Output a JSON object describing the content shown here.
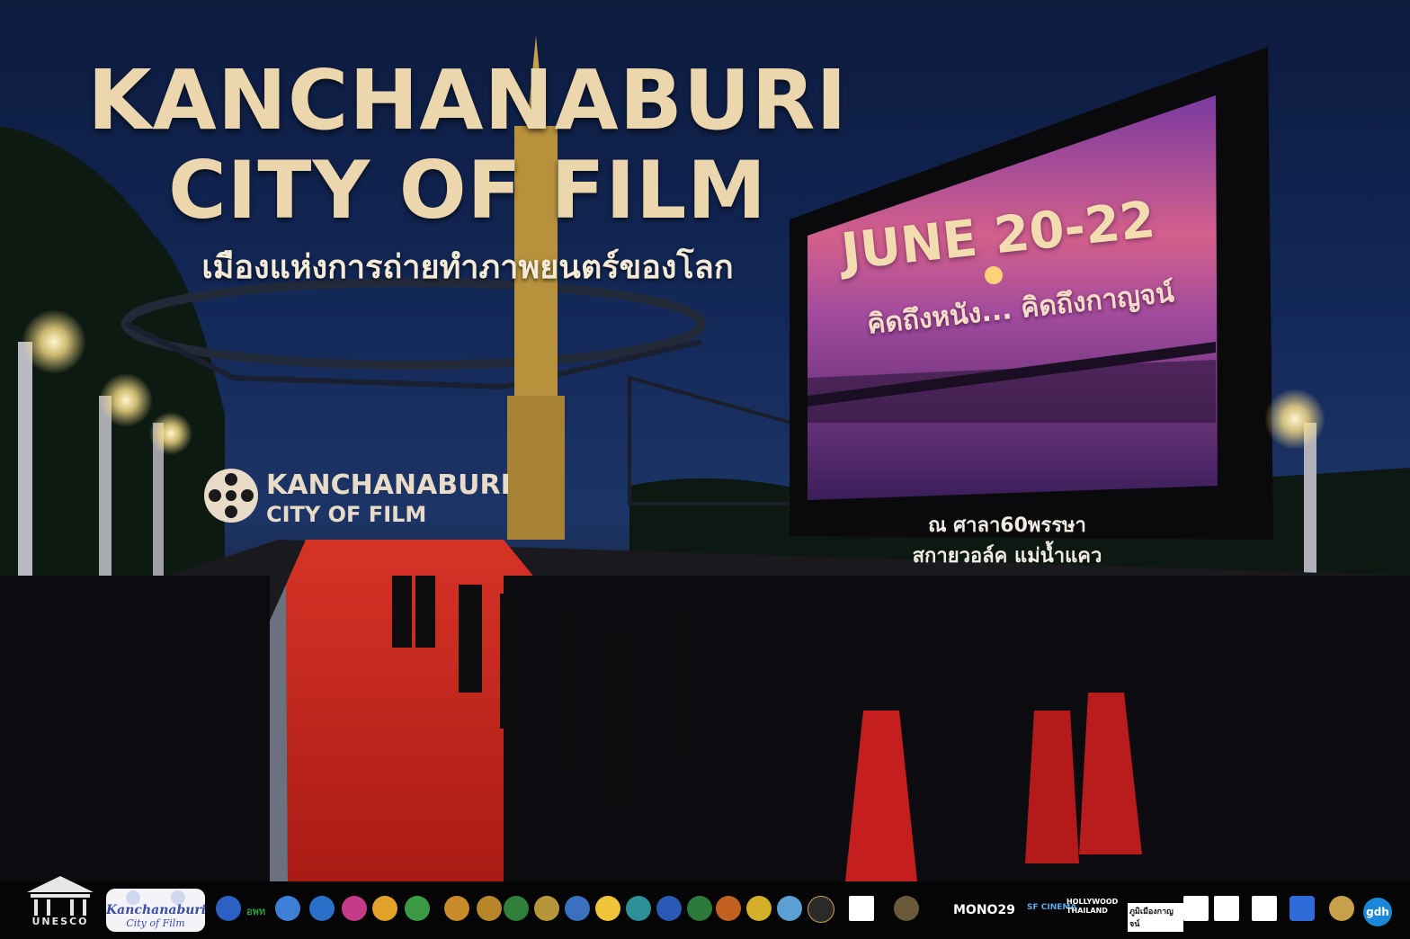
{
  "headline": {
    "line1": "KANCHANABURI",
    "line2": "CITY OF FILM",
    "subtitle": "เมืองแห่งการถ่ายทำภาพยนตร์ของโลก"
  },
  "screen": {
    "date": "JUNE 20-22",
    "tagline": "คิดถึงหนัง... คิดถึงกาญจน์"
  },
  "venue": {
    "line1": "ณ ศาลา60พรรษา",
    "line2": "สกายวอล์ค แม่น้ำแคว"
  },
  "stage_sign": {
    "line1": "KANCHANABURI",
    "line2": "CITY OF FILM"
  },
  "footer": {
    "unesco": "UNESCO",
    "kanchanaburi_logo_line1": "Kanchanaburi",
    "kanchanaburi_logo_line2": "City of Film",
    "partners": [
      {
        "name": "อพท",
        "color": "#2b9b3a"
      },
      {
        "name": "MONO29",
        "color": "#ffffff"
      },
      {
        "name": "SF CINEMA",
        "color": "#1b72c8"
      },
      {
        "name": "HOLLYWOOD THAILAND",
        "color": "#ffffff"
      },
      {
        "name": "ภูมิเมืองกาญจน์",
        "color": "#ffffff"
      },
      {
        "name": "gdh",
        "color": "#1a88d6"
      }
    ]
  },
  "colors": {
    "title": "#ecd6ad",
    "sky": "#13295a",
    "carpet": "#c8231c",
    "screen_glow": "#b04a9a"
  }
}
